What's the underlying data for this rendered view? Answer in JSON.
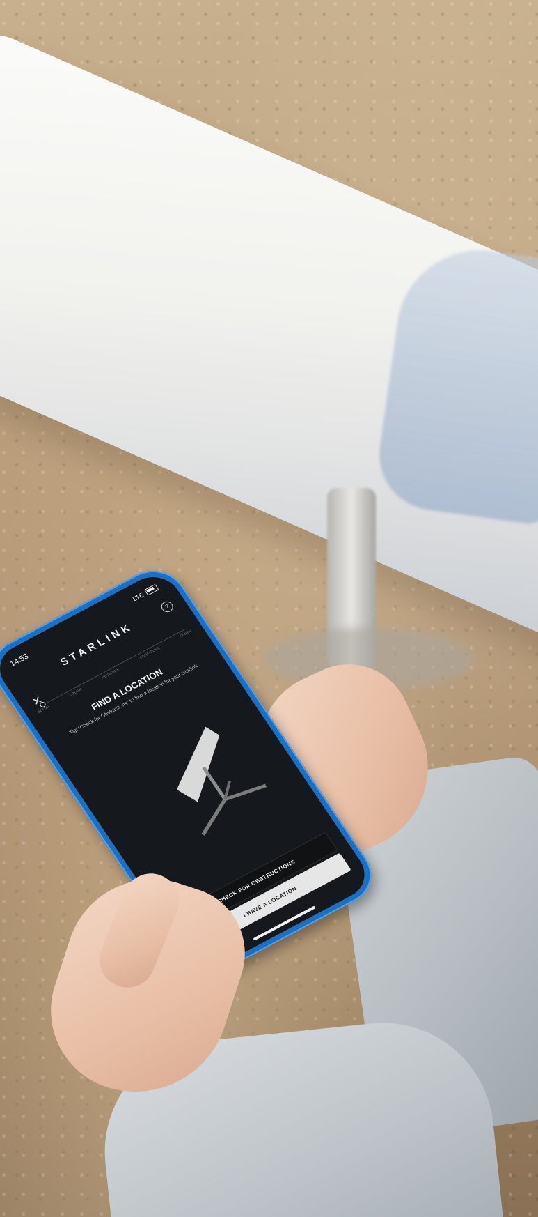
{
  "status_bar": {
    "time": "14:53",
    "signal": "LTE"
  },
  "app": {
    "logo": "STARLINK"
  },
  "setup": {
    "steps": [
      "SETUP",
      "ORDER",
      "NETWORK",
      "CONFIGURE",
      "FINISH"
    ],
    "current_step": "SETUP"
  },
  "screen": {
    "headline": "FIND A LOCATION",
    "subtext": "Tap \"Check for Obstructions\" to find a location for your Starlink"
  },
  "buttons": {
    "primary": "CHECK FOR OBSTRUCTIONS",
    "secondary": "I HAVE A LOCATION"
  },
  "icons": {
    "close": "close-icon",
    "help": "help-icon",
    "battery": "battery-icon"
  },
  "colors": {
    "phone_case": "#1d6fc2",
    "screen_bg": "#15181c",
    "button_light": "#e6e6e6"
  }
}
